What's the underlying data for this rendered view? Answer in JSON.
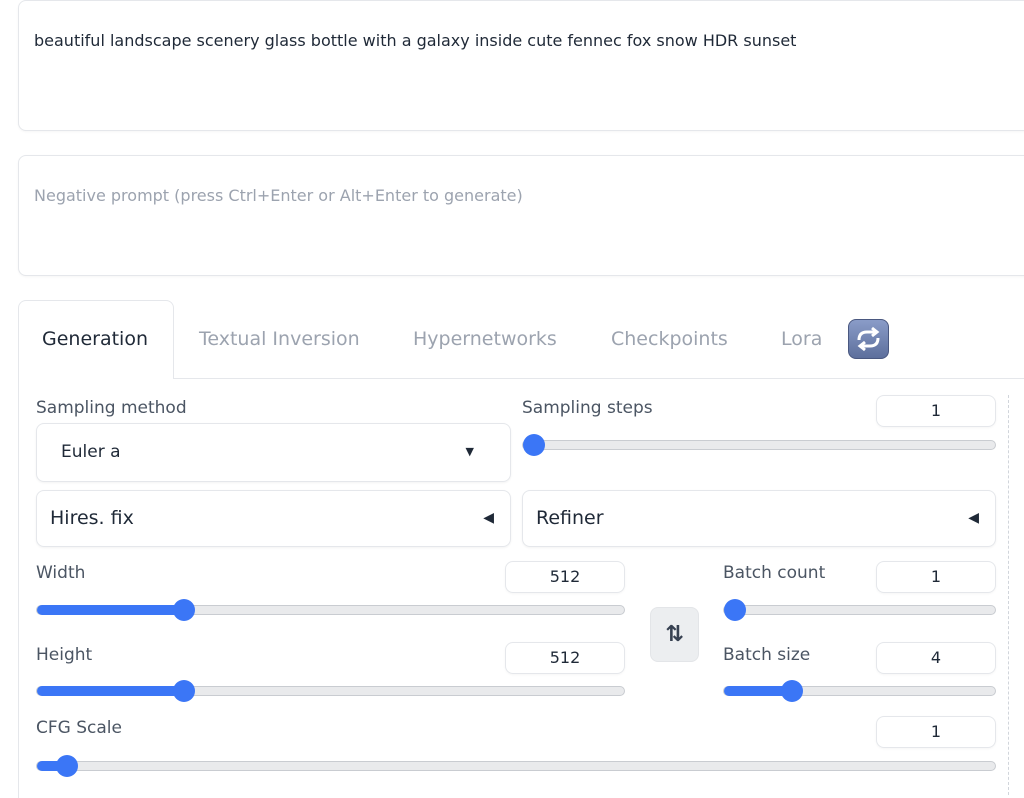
{
  "prompt": {
    "value": "beautiful landscape scenery glass bottle with a galaxy inside cute fennec fox snow HDR sunset"
  },
  "negative_prompt": {
    "placeholder": "Negative prompt (press Ctrl+Enter or Alt+Enter to generate)"
  },
  "tabs": [
    {
      "label": "Generation",
      "active": true
    },
    {
      "label": "Textual Inversion"
    },
    {
      "label": "Hypernetworks"
    },
    {
      "label": "Checkpoints"
    },
    {
      "label": "Lora"
    }
  ],
  "refresh_icon": "refresh-icon",
  "sampling_method": {
    "label": "Sampling method",
    "value": "Euler a"
  },
  "sampling_steps": {
    "label": "Sampling steps",
    "value": "1",
    "level": 0
  },
  "hires_fix": {
    "label": "Hires. fix"
  },
  "refiner": {
    "label": "Refiner"
  },
  "width": {
    "label": "Width",
    "value": "512",
    "level": 0.24
  },
  "height": {
    "label": "Height",
    "value": "512",
    "level": 0.24
  },
  "swap_icon": "swap-arrows-icon",
  "swap_glyph": "⇅",
  "batch_count": {
    "label": "Batch count",
    "value": "1",
    "level": 0
  },
  "batch_size": {
    "label": "Batch size",
    "value": "4",
    "level": 0.23
  },
  "cfg_scale": {
    "label": "CFG Scale",
    "value": "1",
    "level": 0.02
  },
  "colors": {
    "accent": "#3b76f6"
  }
}
